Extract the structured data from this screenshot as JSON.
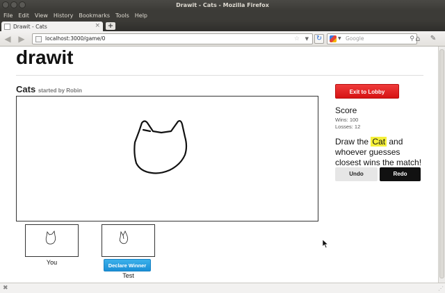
{
  "window": {
    "title": "Drawit - Cats - Mozilla Firefox"
  },
  "menu": [
    "File",
    "Edit",
    "View",
    "History",
    "Bookmarks",
    "Tools",
    "Help"
  ],
  "tab": {
    "title": "Drawit - Cats"
  },
  "nav": {
    "url": "localhost:3000/game/0",
    "search_placeholder": "Google"
  },
  "page": {
    "app_title": "drawit",
    "game": {
      "title": "Cats",
      "subtitle": "started by Robin"
    },
    "players": [
      {
        "label": "You"
      },
      {
        "label": "Test",
        "action": "Declare Winner"
      }
    ],
    "exit_button": "Exit to Lobby",
    "score": {
      "title": "Score",
      "wins": "Wins: 100",
      "losses": "Losses: 12"
    },
    "instruction": {
      "before": "Draw the ",
      "word": "Cat",
      "after": " and whoever guesses closest wins the match!"
    },
    "undo_label": "Undo",
    "redo_label": "Redo"
  },
  "colors": {
    "exit_red": "#d61313",
    "declare_blue": "#1a8fd6",
    "highlight": "#f5f03a",
    "redo_black": "#111111"
  }
}
